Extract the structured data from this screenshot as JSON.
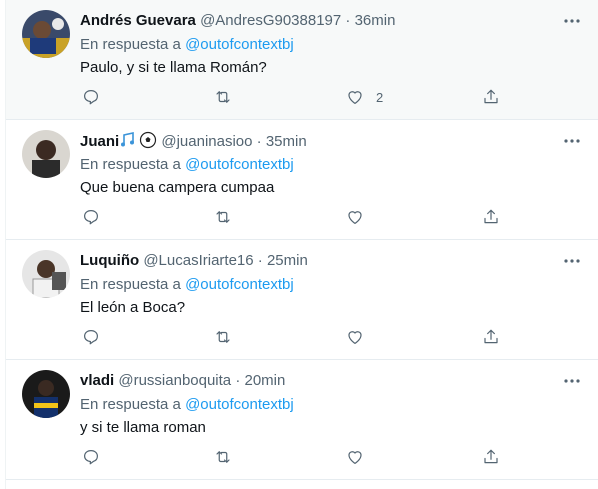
{
  "colors": {
    "link": "#1d9bf0",
    "muted": "#536471",
    "text": "#0f1419",
    "highlight_bg": "#f7f9f9"
  },
  "tweets": [
    {
      "name": "Andrés Guevara",
      "handle": "@AndresG90388197",
      "dot": "·",
      "time": "36min",
      "reply_prefix": "En respuesta a",
      "reply_to": "@outofcontextbj",
      "text": "Paulo, y si te llama Román?",
      "like_count": "2",
      "icons": [
        "reply-icon",
        "retweet-icon",
        "heart-icon",
        "share-icon",
        "more-icon"
      ]
    },
    {
      "name": "Juani",
      "name_emoji": [
        "music-notes-emoji",
        "soccer-ball-emoji"
      ],
      "handle": "@juaninasioo",
      "dot": "·",
      "time": "35min",
      "reply_prefix": "En respuesta a",
      "reply_to": "@outofcontextbj",
      "text": "Que buena campera cumpaa",
      "like_count": ""
    },
    {
      "name": "Luquiño",
      "handle": "@LucasIriarte16",
      "dot": "·",
      "time": "25min",
      "reply_prefix": "En respuesta a",
      "reply_to": "@outofcontextbj",
      "text": "El león a Boca?",
      "like_count": ""
    },
    {
      "name": "vladi",
      "handle": "@russianboquita",
      "dot": "·",
      "time": "20min",
      "reply_prefix": "En respuesta a",
      "reply_to": "@outofcontextbj",
      "text": "y si te llama roman",
      "like_count": ""
    }
  ]
}
